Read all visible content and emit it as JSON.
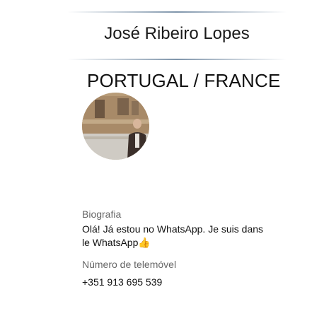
{
  "profile": {
    "name": "José Ribeiro Lopes",
    "location": "PORTUGAL / FRANCE"
  },
  "about": {
    "label": "Biografia",
    "text": "Olá! Já estou no WhatsApp.  Je suis dans le WhatsApp",
    "emoji": "👍"
  },
  "phone": {
    "label": "Número de telemóvel",
    "value": "+351 913 695 539"
  },
  "colors": {
    "divider": "#7f95ab",
    "label_gray": "#666666",
    "text_dark": "#111111"
  }
}
